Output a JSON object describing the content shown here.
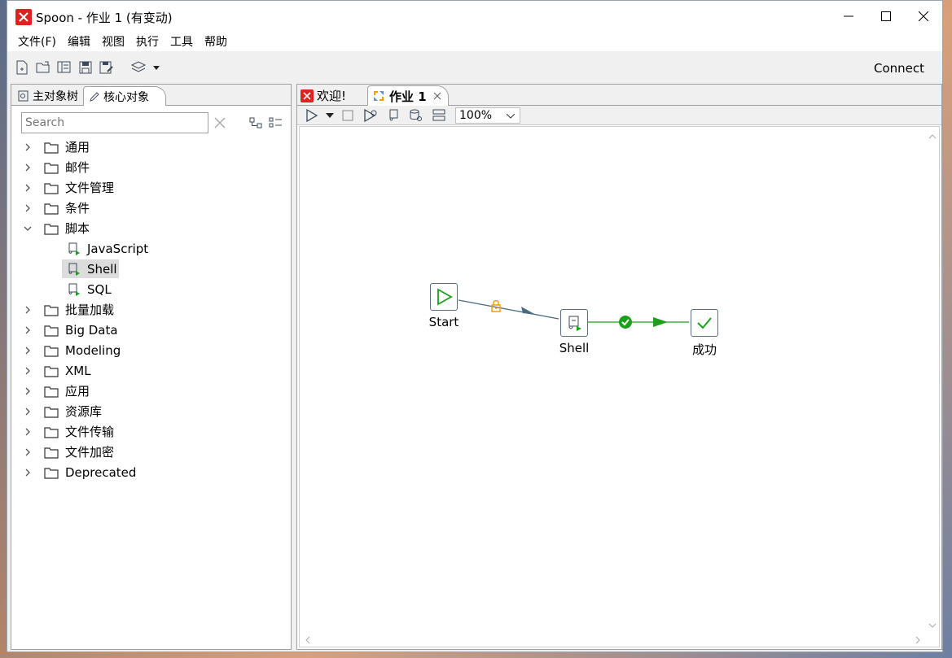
{
  "window": {
    "title": "Spoon - 作业 1 (有变动)"
  },
  "menu": [
    "文件(F)",
    "编辑",
    "视图",
    "执行",
    "工具",
    "帮助"
  ],
  "toolbar": {
    "connect_label": "Connect"
  },
  "left_panel": {
    "tabs": [
      "主对象树",
      "核心对象"
    ],
    "search_placeholder": "Search",
    "tree": [
      {
        "label": "通用",
        "expanded": false
      },
      {
        "label": "邮件",
        "expanded": false
      },
      {
        "label": "文件管理",
        "expanded": false
      },
      {
        "label": "条件",
        "expanded": false
      },
      {
        "label": "脚本",
        "expanded": true
      },
      {
        "label": "JavaScript",
        "child": true
      },
      {
        "label": "Shell",
        "child": true,
        "selected": true
      },
      {
        "label": "SQL",
        "child": true
      },
      {
        "label": "批量加载",
        "expanded": false
      },
      {
        "label": "Big Data",
        "expanded": false
      },
      {
        "label": "Modeling",
        "expanded": false
      },
      {
        "label": "XML",
        "expanded": false
      },
      {
        "label": "应用",
        "expanded": false
      },
      {
        "label": "资源库",
        "expanded": false
      },
      {
        "label": "文件传输",
        "expanded": false
      },
      {
        "label": "文件加密",
        "expanded": false
      },
      {
        "label": "Deprecated",
        "expanded": false
      }
    ]
  },
  "editor": {
    "tabs": [
      "欢迎!",
      "作业 1"
    ],
    "zoom": "100%",
    "nodes": {
      "start": "Start",
      "shell": "Shell",
      "success": "成功"
    }
  },
  "colors": {
    "accent_green": "#1aa01a",
    "lock_orange": "#f0a000",
    "hop_blue": "#4a6a80"
  }
}
